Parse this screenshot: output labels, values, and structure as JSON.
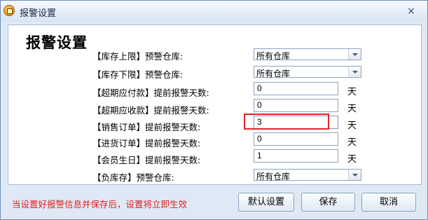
{
  "window": {
    "title": "报警设置",
    "close_glyph": "×"
  },
  "heading": "报警设置",
  "rows": [
    {
      "label": "【库存上限】预警仓库:",
      "type": "select",
      "value": "所有仓库"
    },
    {
      "label": "【库存下限】预警仓库:",
      "type": "select",
      "value": "所有仓库"
    },
    {
      "label": "【超期应付款】提前报警天数:",
      "type": "number",
      "value": "0",
      "unit": "天"
    },
    {
      "label": "【超期应收款】提前报警天数:",
      "type": "number",
      "value": "0",
      "unit": "天"
    },
    {
      "label": "【销售订单】提前报警天数:",
      "type": "number",
      "value": "3",
      "unit": "天",
      "highlighted": true
    },
    {
      "label": "【进货订单】提前报警天数:",
      "type": "number",
      "value": "0",
      "unit": "天"
    },
    {
      "label": "【会员生日】提前报警天数:",
      "type": "number",
      "value": "1",
      "unit": "天"
    },
    {
      "label": "【负库存】预警仓库:",
      "type": "select",
      "value": "所有仓库"
    }
  ],
  "note": "当设置好报警信息并保存后，设置将立即生效",
  "buttons": {
    "default": "默认设置",
    "save": "保存",
    "cancel": "取消"
  },
  "colors": {
    "highlight_border": "#e0262a",
    "note_text": "#e02020",
    "window_bg": "#dfe9f5"
  }
}
